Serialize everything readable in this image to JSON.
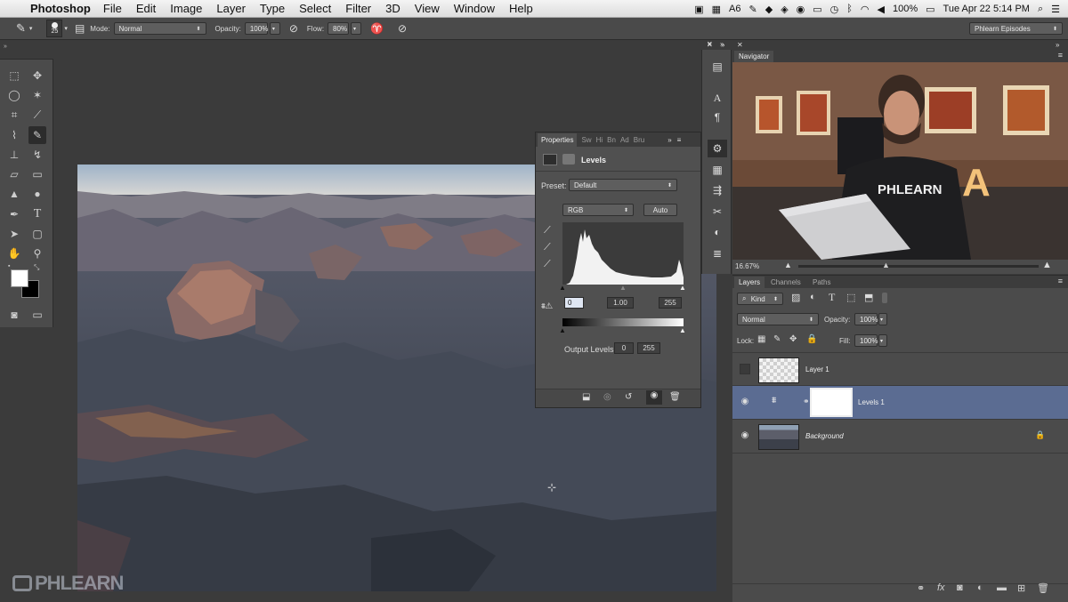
{
  "menubar": {
    "app": "Photoshop",
    "items": [
      "File",
      "Edit",
      "Image",
      "Layer",
      "Type",
      "Select",
      "Filter",
      "3D",
      "View",
      "Window",
      "Help"
    ],
    "status_6": "6",
    "battery": "100%",
    "datetime": "Tue Apr 22  5:14 PM"
  },
  "options": {
    "brush_size": "25",
    "mode_label": "Mode:",
    "mode": "Normal",
    "opacity_label": "Opacity:",
    "opacity": "100%",
    "flow_label": "Flow:",
    "flow": "80%",
    "workspace": "Phlearn Episodes"
  },
  "properties": {
    "tabs": [
      "Properties",
      "Sw",
      "Hi",
      "Bn",
      "Ad",
      "Bru"
    ],
    "title": "Levels",
    "preset_label": "Preset:",
    "preset": "Default",
    "channel": "RGB",
    "auto": "Auto",
    "input_black": "0",
    "input_gamma": "1.00",
    "input_white": "255",
    "output_label": "Output Levels:",
    "output_black": "0",
    "output_white": "255"
  },
  "navigator": {
    "title": "Navigator",
    "zoom": "16.67%",
    "shirt_text": "PHLEARN"
  },
  "layers": {
    "tabs": [
      "Layers",
      "Channels",
      "Paths"
    ],
    "kind": "Kind",
    "blend": "Normal",
    "opacity_label": "Opacity:",
    "opacity": "100%",
    "lock_label": "Lock:",
    "fill_label": "Fill:",
    "fill": "100%",
    "items": [
      {
        "name": "Layer 1"
      },
      {
        "name": "Levels 1"
      },
      {
        "name": "Background"
      }
    ]
  },
  "watermark": "PHLEARN"
}
